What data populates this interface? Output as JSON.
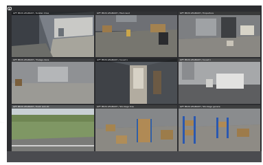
{
  "cameras": [
    {
      "label": "GFF PRUS LEGMAN7 / Rolster drive"
    },
    {
      "label": "GFF PRUS LEGMAN7 / Plein laud"
    },
    {
      "label": "GFF PRUS LEGMAN7 / Proparture"
    },
    {
      "label": "GFF PRUS LEGMAN7 / Tralage dans"
    },
    {
      "label": "GFF PRUS LEGMAN7 / Cuvet 1"
    },
    {
      "label": "GFF PRUS LEGMAN7 / Cuvet 1"
    },
    {
      "label": "GFF PRUS LEGMAN7 / Poldr LGS 20"
    },
    {
      "label": "GFF PRUS LEGMAN7 / Stockage tras"
    },
    {
      "label": "GFF PRUS LEGMAN7 / Stockage genere"
    }
  ],
  "colors": {
    "frame": "#2c2d30",
    "footer": "#4a4b4f",
    "label_text": "#f0f0f0"
  },
  "icons": {
    "top_left": "camera-icon"
  }
}
